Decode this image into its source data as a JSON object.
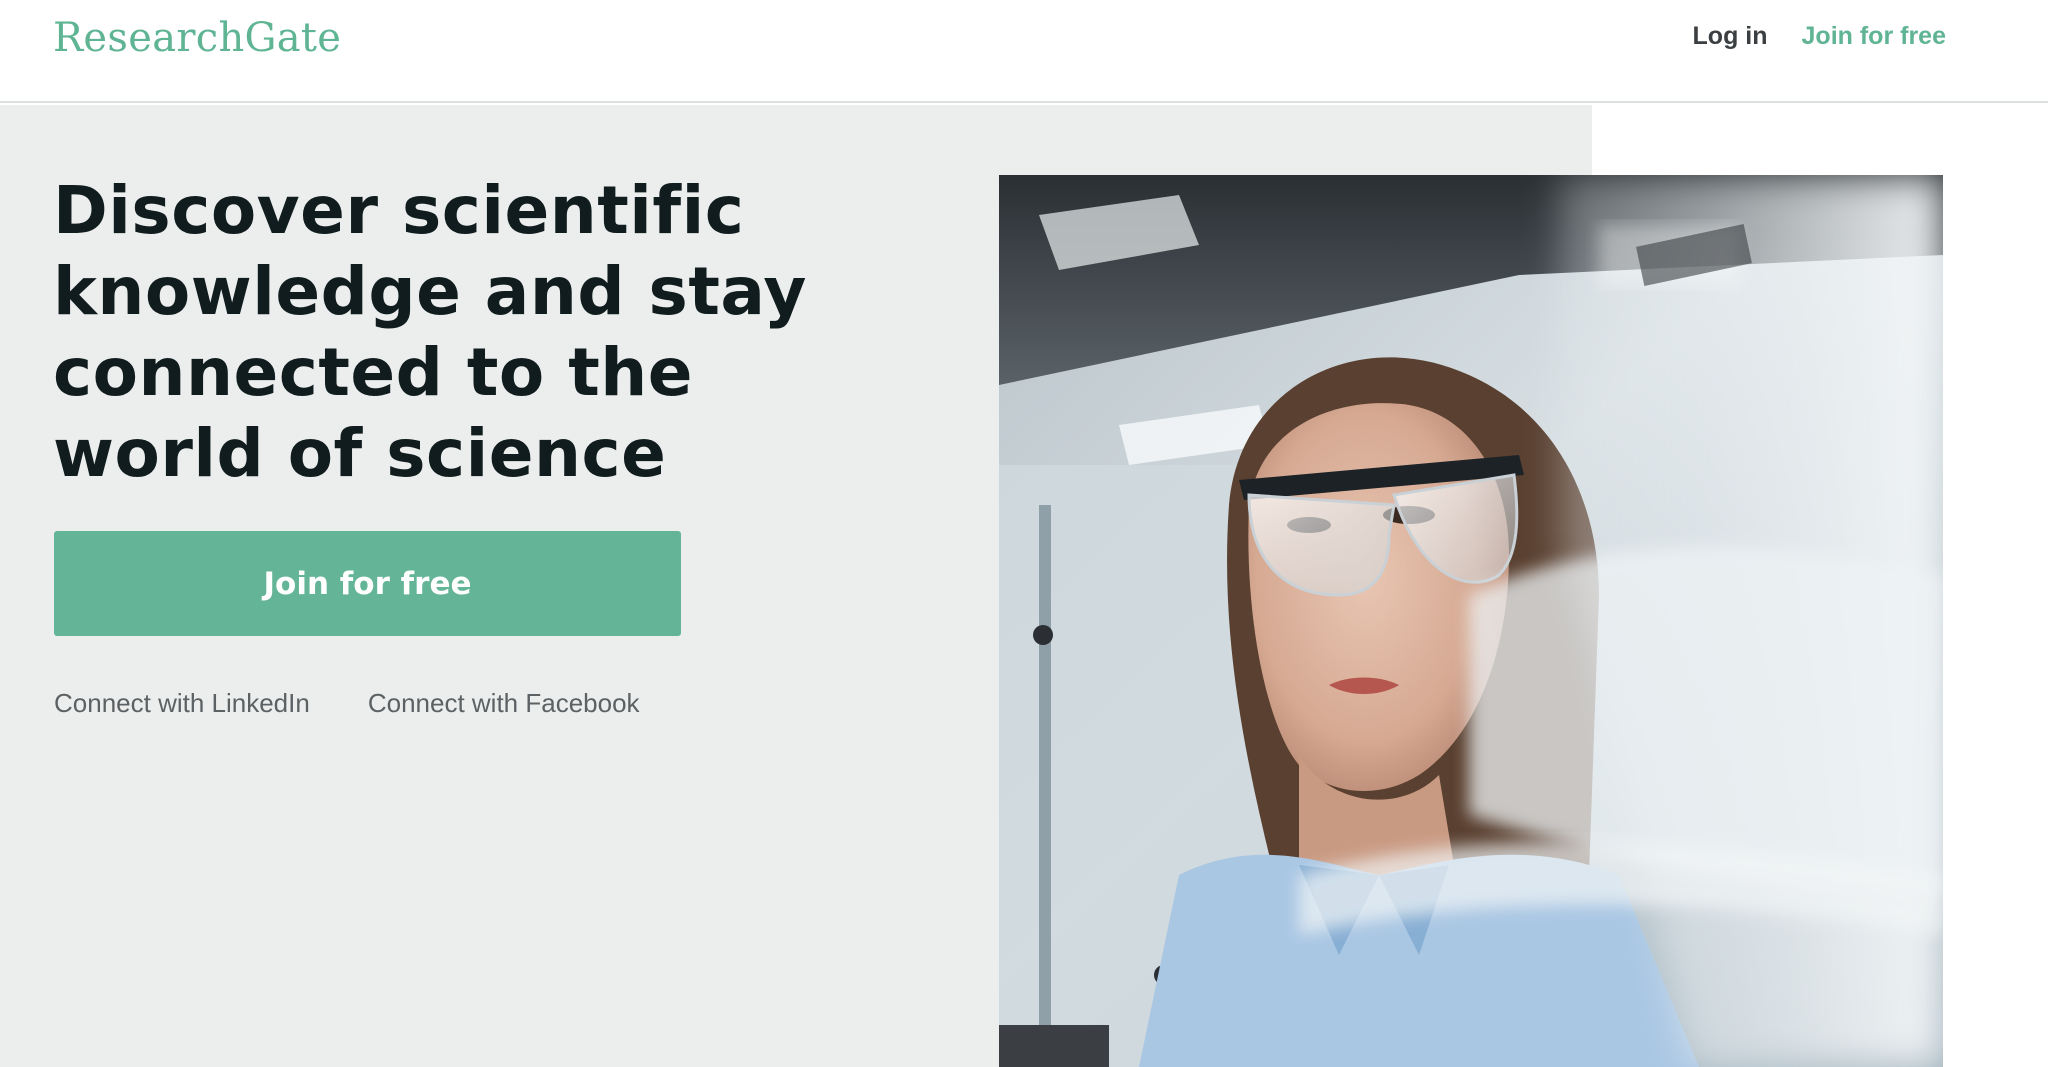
{
  "header": {
    "logo_text": "ResearchGate",
    "login_label": "Log in",
    "join_label": "Join for free"
  },
  "hero": {
    "headline": "Discover scientific knowledge and stay connected to the world of science",
    "cta_label": "Join for free",
    "linkedin_label": "Connect with LinkedIn",
    "facebook_label": "Connect with Facebook"
  },
  "colors": {
    "brand": "#5fb494",
    "hero_background": "#eceeed",
    "headline": "#111c1e"
  }
}
